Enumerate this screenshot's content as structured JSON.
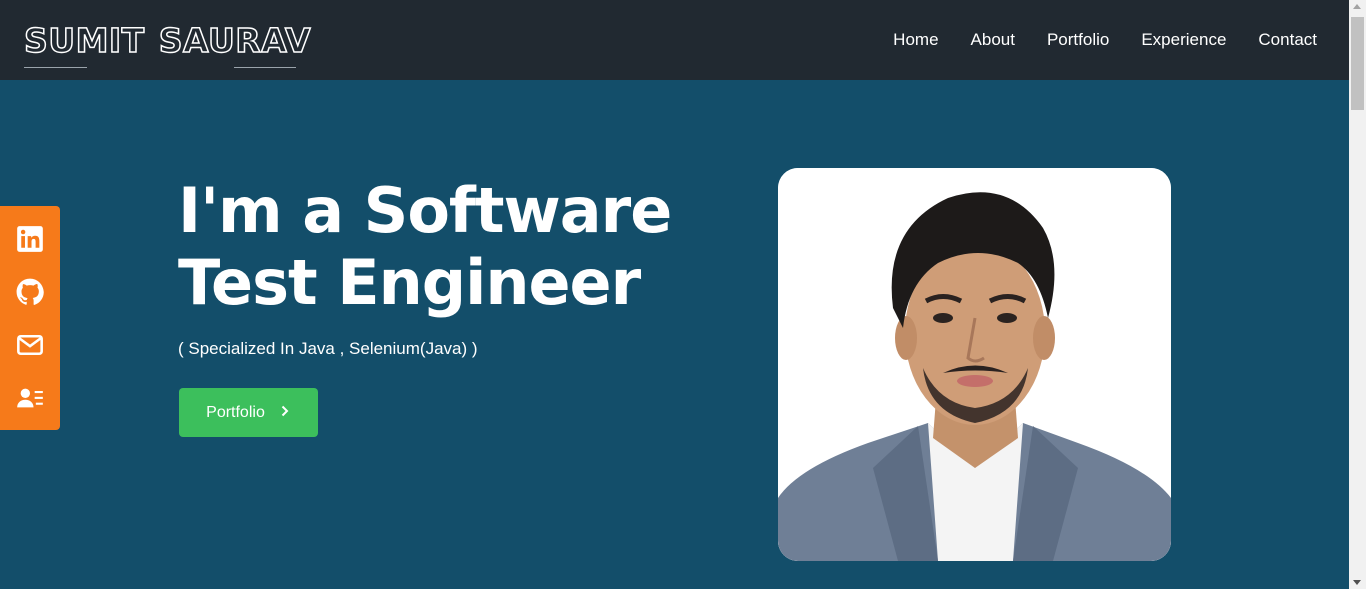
{
  "header": {
    "logo_first": "SUMIT",
    "logo_last": "SAURAV",
    "nav": [
      {
        "label": "Home"
      },
      {
        "label": "About"
      },
      {
        "label": "Portfolio"
      },
      {
        "label": "Experience"
      },
      {
        "label": "Contact"
      }
    ]
  },
  "social": [
    {
      "icon": "linkedin-icon"
    },
    {
      "icon": "github-icon"
    },
    {
      "icon": "mail-icon"
    },
    {
      "icon": "resume-icon"
    }
  ],
  "hero": {
    "title_line1": "I'm a Software",
    "title_line2": "Test Engineer",
    "subtitle": "( Specialized In Java , Selenium(Java) )",
    "button_label": "Portfolio"
  },
  "colors": {
    "navbar": "#212931",
    "hero_bg": "#134e6a",
    "social_bar": "#f67a1a",
    "button": "#3cbf5c"
  }
}
